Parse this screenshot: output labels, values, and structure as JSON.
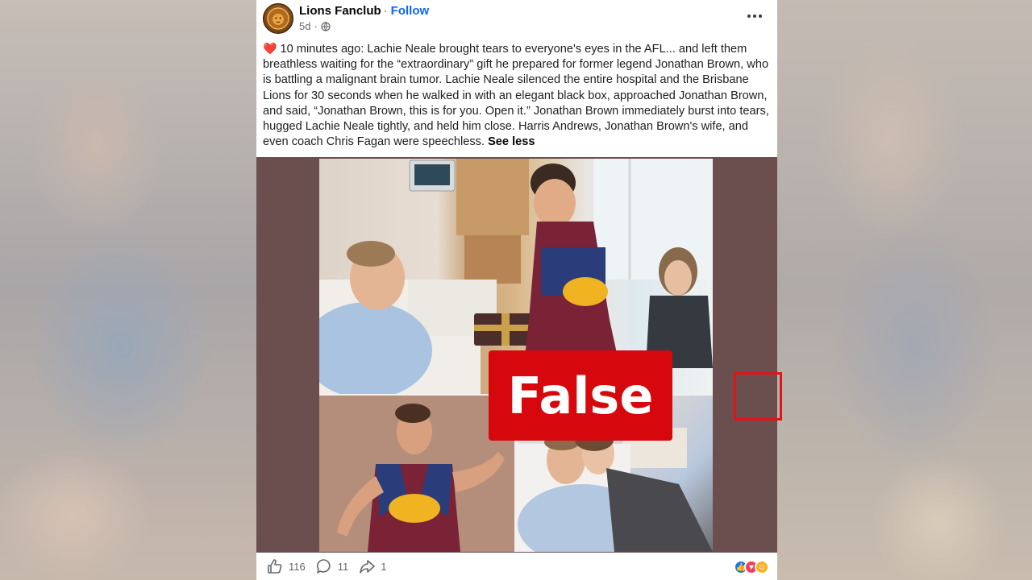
{
  "post": {
    "page_name": "Lions Fanclub",
    "separator": "·",
    "follow_label": "Follow",
    "time_ago": "5d",
    "audience_icon": "globe-icon",
    "more_icon": "more-options-icon",
    "caption_emoji": "❤️",
    "caption": "10 minutes ago: Lachie Neale brought tears to everyone's eyes in the AFL... and left them breathless waiting for the “extraordinary” gift he prepared for former legend Jonathan Brown, who is battling a malignant brain tumor. Lachie Neale silenced the entire hospital and the Brisbane Lions for 30 seconds when he walked in with an elegant black box, approached Jonathan Brown, and said, “Jonathan Brown, this is for you. Open it.” Jonathan Brown immediately burst into tears, hugged Lachie Neale tightly, and held him close. Harris Andrews, Jonathan Brown's wife, and even coach Chris Fagan were speechless.",
    "see_less_label": "See less"
  },
  "media": {
    "verdict_label": "False",
    "verdict_color": "#d7080d",
    "tiles": [
      {
        "name": "hospital-gift-scene"
      },
      {
        "name": "player-celebrating"
      },
      {
        "name": "patient-with-woman"
      }
    ]
  },
  "actions": {
    "like_count": "116",
    "comment_count": "11",
    "share_count": "1",
    "reactions": [
      "like",
      "love",
      "care"
    ]
  },
  "colors": {
    "link": "#0866ff",
    "media_bg": "#6b4f4f",
    "text": "#1c1e21",
    "muted": "#65676b"
  }
}
